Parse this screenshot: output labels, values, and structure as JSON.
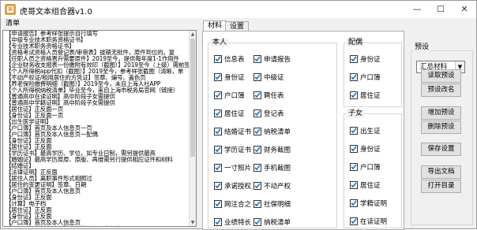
{
  "window": {
    "title": "虎哥文本组合器v1.0",
    "minimize_glyph": "—",
    "maximize_glyph": "☐",
    "close_glyph": "✕"
  },
  "list_group": {
    "title": "清单",
    "lines": [
      "【申请报告】参考样张提示自行填写",
      "【中级专业技术职务资格证书】",
      "【专业技术职务资格证书】",
      "【资格考试资格人员登记表/审审表】拔萌无批件，原件到位的，复",
      "【任职人员之资格晋升需要原件】2019至今，提供每年度1-1作用件",
      "【企业财务收支报表一份缴附有效印（截图）】2019至今（上级）需前签",
      "【个人所得税app代扣（截图）】2019至今，参考样张截图（清晰，单",
      "【不动产权证/租用居住的方凭证】签章、编号、盖色页",
      "【养老保险缴费明细（截图）】2019至今，未自上海人社APP",
      "【个人所得税纳税清单】毕业至今，来自上海市税务局官网（链接）",
      "【普通高中在读证明】高中阶段子女需提供",
      "【普通高中学籍证明】高中阶段子女需提供",
      "【居住证】正反面一页",
      "【身份证】正反面一页",
      "【出生医学证明】",
      "【户口簿】首页及本人信息页一页",
      "【户口簿】首页及本人信息页一配偶",
      "【身份证】正反面",
      "【居住证】正反面",
      "【学历证书】最高学历、学位，如专业日制，需另提供最高",
      "【婚姻证】最高学历原原、原版、再维需另行提供相应证件和材料",
      "【结婚证】",
      "【法律证明】正反面",
      "【居住人员】离职事件形式相照过",
      "【居住的变更证明】签章、日期",
      "【户口簿】首页及本人信息页",
      "【身份证】正反面",
      "【计算】电子档",
      "【居住证】正反面",
      "【身份证】正反面",
      "【户口簿】首页及本人信息页",
      "【个人工作业绩表持书】参考样张提示自行填写"
    ]
  },
  "tabs": [
    {
      "label": "材料"
    },
    {
      "label": "设置"
    }
  ],
  "groups": {
    "self": {
      "title": "本人"
    },
    "spouse": {
      "title": "配偶"
    },
    "child": {
      "title": "子女"
    },
    "preset": {
      "title": "预设"
    }
  },
  "self_items": [
    {
      "label": "信息表",
      "checked": true
    },
    {
      "label": "申请报告",
      "checked": true
    },
    {
      "label": "身份证",
      "checked": true
    },
    {
      "label": "中级证",
      "checked": true
    },
    {
      "label": "户口簿",
      "checked": true
    },
    {
      "label": "聘任表",
      "checked": true
    },
    {
      "label": "居住证",
      "checked": true
    },
    {
      "label": "登记表",
      "checked": true
    },
    {
      "label": "结婚证书",
      "checked": true
    },
    {
      "label": "纳税清单",
      "checked": true
    },
    {
      "label": "学历证书",
      "checked": true
    },
    {
      "label": "财务截图",
      "checked": true
    },
    {
      "label": "一寸照片",
      "checked": true
    },
    {
      "label": "手机截图",
      "checked": true
    },
    {
      "label": "承诺授权",
      "checked": true
    },
    {
      "label": "不动产权",
      "checked": true
    },
    {
      "label": "网注合之",
      "checked": true
    },
    {
      "label": "社保明细",
      "checked": true
    },
    {
      "label": "业绩特长",
      "checked": true
    },
    {
      "label": "纳税清单",
      "checked": true
    }
  ],
  "spouse_items": [
    {
      "label": "身份证",
      "checked": true
    },
    {
      "label": "户口簿",
      "checked": true
    },
    {
      "label": "居住证",
      "checked": true
    }
  ],
  "child_items": [
    {
      "label": "出生证",
      "checked": true
    },
    {
      "label": "身份证",
      "checked": true
    },
    {
      "label": "户口簿",
      "checked": true
    },
    {
      "label": "居住证",
      "checked": true
    },
    {
      "label": "学籍证明",
      "checked": true
    },
    {
      "label": "在读证明",
      "checked": true
    }
  ],
  "preset": {
    "selected": "汇总材料",
    "dropdown_glyph": "▼",
    "buttons": [
      {
        "label": "读取预设"
      },
      {
        "label": "预设改名"
      },
      {
        "label": "增加预设"
      },
      {
        "label": "删除预设"
      },
      {
        "label": "保存设置"
      },
      {
        "label": "导出文档"
      },
      {
        "label": "打开目录"
      }
    ]
  },
  "colors": {
    "check_tick": "#1a73c9",
    "list_border": "#828790",
    "tab_active": "#ffffff"
  }
}
